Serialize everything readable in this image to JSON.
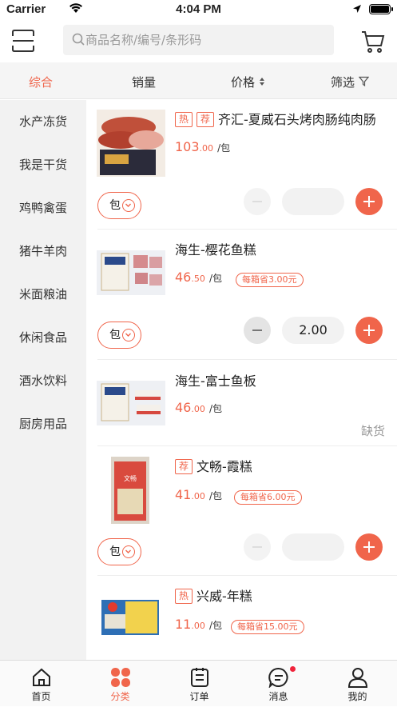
{
  "status": {
    "carrier": "Carrier",
    "time": "4:04 PM"
  },
  "search": {
    "placeholder": "商品名称/编号/条形码"
  },
  "sort": {
    "all": "综合",
    "sales": "销量",
    "price": "价格",
    "filter": "筛选"
  },
  "sidebar": {
    "items": [
      "水产冻货",
      "我是干货",
      "鸡鸭禽蛋",
      "猪牛羊肉",
      "米面粮油",
      "休闲食品",
      "酒水饮料",
      "厨房用品"
    ]
  },
  "products": [
    {
      "tags": [
        "热",
        "荐"
      ],
      "name": "齐汇-夏威石头烤肉肠纯肉肠",
      "price_int": "103",
      "price_dec": ".00",
      "unit": "/包",
      "saving": "",
      "select_unit": "包",
      "quantity": "",
      "status": ""
    },
    {
      "tags": [],
      "name": "海生-樱花鱼糕",
      "price_int": "46",
      "price_dec": ".50",
      "unit": "/包",
      "saving": "每箱省3.00元",
      "select_unit": "包",
      "quantity": "2.00",
      "status": ""
    },
    {
      "tags": [],
      "name": "海生-富士鱼板",
      "price_int": "46",
      "price_dec": ".00",
      "unit": "/包",
      "saving": "",
      "select_unit": "",
      "quantity": "",
      "status": "缺货"
    },
    {
      "tags": [
        "荐"
      ],
      "name": "文畅-霞糕",
      "price_int": "41",
      "price_dec": ".00",
      "unit": "/包",
      "saving": "每箱省6.00元",
      "select_unit": "包",
      "quantity": "",
      "status": ""
    },
    {
      "tags": [
        "热"
      ],
      "name": "兴威-年糕",
      "price_int": "11",
      "price_dec": ".00",
      "unit": "/包",
      "saving": "每箱省15.00元",
      "select_unit": "",
      "quantity": "",
      "status": ""
    }
  ],
  "tabbar": {
    "home": "首页",
    "category": "分类",
    "orders": "订单",
    "messages": "消息",
    "mine": "我的"
  },
  "colors": {
    "accent": "#f0654b",
    "badge": "#f0233b"
  }
}
